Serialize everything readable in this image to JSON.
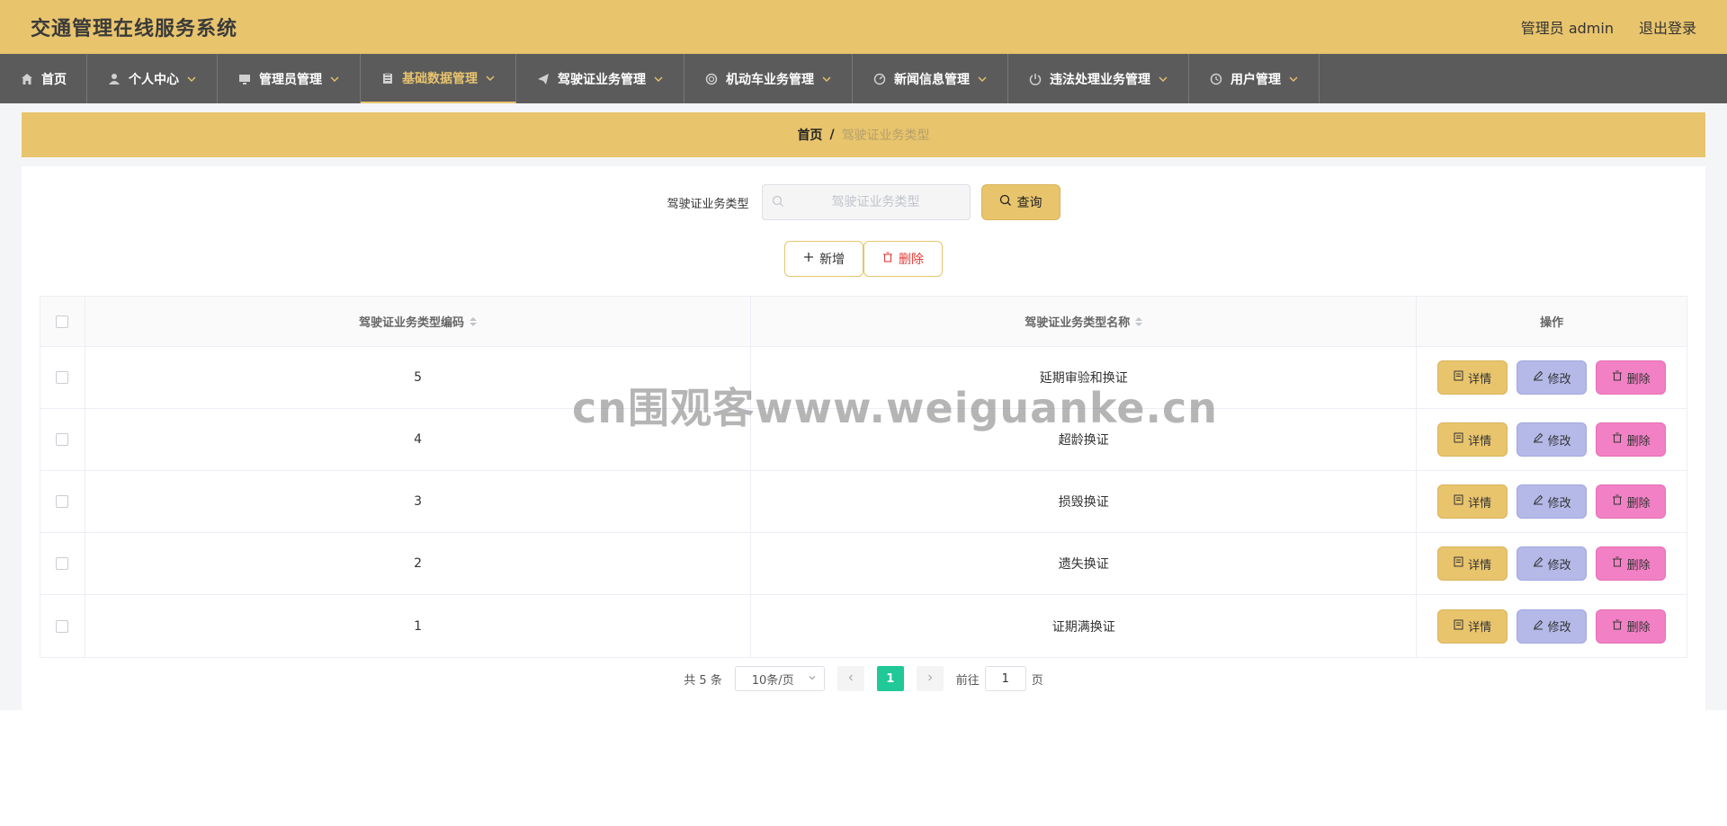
{
  "header": {
    "title": "交通管理在线服务系统",
    "admin_label": "管理员 admin",
    "logout_label": "退出登录"
  },
  "nav": {
    "items": [
      {
        "label": "首页",
        "icon": "home-icon"
      },
      {
        "label": "个人中心",
        "icon": "user-icon"
      },
      {
        "label": "管理员管理",
        "icon": "monitor-icon"
      },
      {
        "label": "基础数据管理",
        "icon": "clipboard-icon"
      },
      {
        "label": "驾驶证业务管理",
        "icon": "paper-plane-icon"
      },
      {
        "label": "机动车业务管理",
        "icon": "circle-icon"
      },
      {
        "label": "新闻信息管理",
        "icon": "gauge-icon"
      },
      {
        "label": "违法处理业务管理",
        "icon": "power-icon"
      },
      {
        "label": "用户管理",
        "icon": "clock-icon"
      }
    ]
  },
  "breadcrumb": {
    "home": "首页",
    "separator": "/",
    "current": "驾驶证业务类型"
  },
  "search": {
    "label": "驾驶证业务类型",
    "placeholder": "驾驶证业务类型",
    "value": "",
    "button_label": "查询"
  },
  "actions": {
    "add_label": "新增",
    "delete_label": "删除"
  },
  "table": {
    "columns": [
      "驾驶证业务类型编码",
      "驾驶证业务类型名称",
      "操作"
    ],
    "rows": [
      {
        "code": "5",
        "name": "延期审验和换证"
      },
      {
        "code": "4",
        "name": "超龄换证"
      },
      {
        "code": "3",
        "name": "损毁换证"
      },
      {
        "code": "2",
        "name": "遗失换证"
      },
      {
        "code": "1",
        "name": "证期满换证"
      }
    ],
    "op_detail": "详情",
    "op_edit": "修改",
    "op_delete": "删除"
  },
  "pagination": {
    "total_text": "共 5 条",
    "page_size": "10条/页",
    "current_page": "1",
    "goto_label": "前往",
    "goto_value": "1",
    "page_unit": "页"
  },
  "watermark": "cn围观客www.weiguanke.cn",
  "colors": {
    "accent": "#e8c46d",
    "nav_bg": "#5b5b5b",
    "edit_btn": "#b4b9e8",
    "delete_btn": "#f280c4",
    "page_active": "#20c997"
  }
}
